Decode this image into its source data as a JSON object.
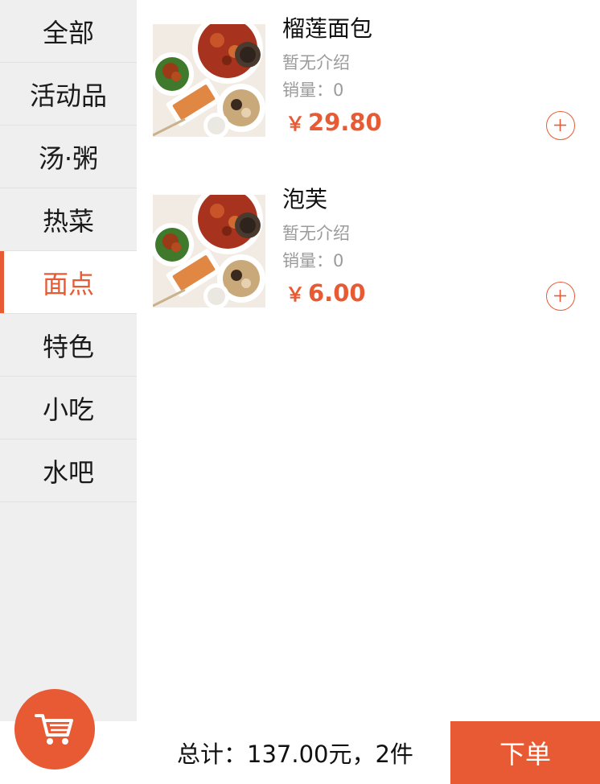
{
  "accent_color": "#e85a33",
  "sidebar": {
    "items": [
      {
        "label": "全部",
        "active": false
      },
      {
        "label": "活动品",
        "active": false
      },
      {
        "label": "汤·粥",
        "active": false
      },
      {
        "label": "热菜",
        "active": false
      },
      {
        "label": "面点",
        "active": true
      },
      {
        "label": "特色",
        "active": false
      },
      {
        "label": "小吃",
        "active": false
      },
      {
        "label": "水吧",
        "active": false
      }
    ]
  },
  "products": [
    {
      "name": "榴莲面包",
      "description": "暂无介绍",
      "sales": "销量：0",
      "currency": "￥",
      "price": "29.80",
      "image_icon": "food-platter-image",
      "add_icon": "plus-circle-icon"
    },
    {
      "name": "泡芙",
      "description": "暂无介绍",
      "sales": "销量：0",
      "currency": "￥",
      "price": "6.00",
      "image_icon": "food-platter-image",
      "add_icon": "plus-circle-icon"
    }
  ],
  "footer": {
    "total": "总计：137.00元，2件",
    "order_label": "下单",
    "cart_icon": "shopping-cart-icon"
  }
}
